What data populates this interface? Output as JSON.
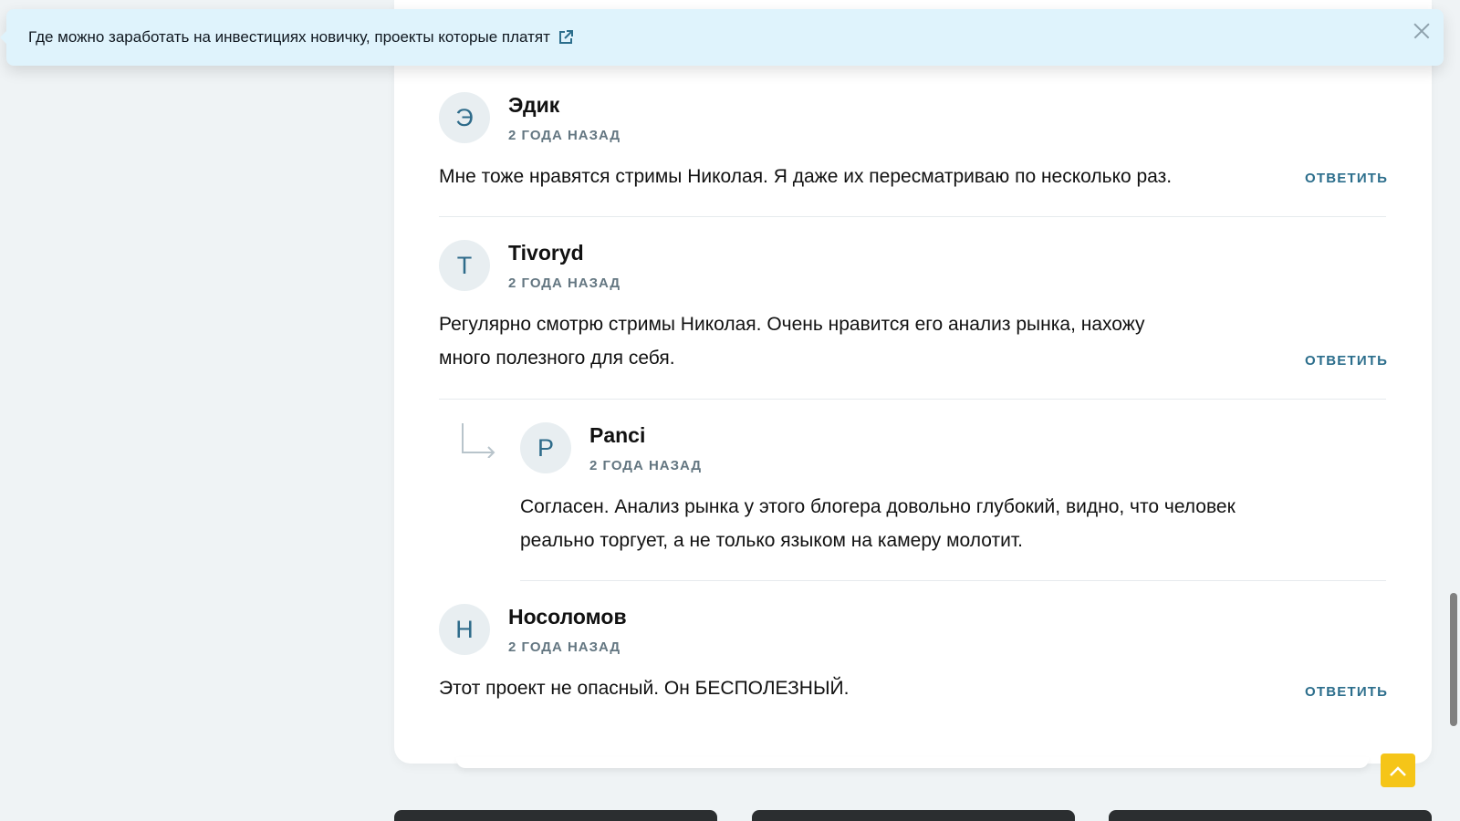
{
  "banner": {
    "link_text": "Где можно заработать на инвестициях новичку, проекты которые платят",
    "icons": {
      "external": "external-link-icon",
      "close": "close-icon"
    }
  },
  "comments": [
    {
      "avatar_letter": "Э",
      "author": "Эдик",
      "date": "2 ГОДА НАЗАД",
      "lines": [
        "Мне тоже нравятся стримы Николая. Я даже их пересматриваю по несколько раз."
      ],
      "reply_label": "ОТВЕТИТЬ"
    },
    {
      "avatar_letter": "T",
      "author": "Tivoryd",
      "date": "2 ГОДА НАЗАД",
      "lines": [
        "Регулярно смотрю стримы Николая. Очень нравится его анализ рынка, нахожу",
        "много полезного для себя."
      ],
      "reply_label": "ОТВЕТИТЬ"
    },
    {
      "avatar_letter": "P",
      "author": "Panci",
      "date": "2 ГОДА НАЗАД",
      "lines": [
        "Согласен. Анализ рынка у этого блогера довольно глубокий, видно, что человек",
        "реально торгует, а не только языком на камеру молотит."
      ]
    },
    {
      "avatar_letter": "Н",
      "author": "Носоломов",
      "date": "2 ГОДА НАЗАД",
      "lines": [
        "Этот проект не опасный. Он БЕСПОЛЕЗНЫЙ."
      ],
      "reply_label": "ОТВЕТИТЬ"
    }
  ],
  "colors": {
    "accent": "#2c6e8c",
    "banner_bg": "#dff3fc",
    "scroll_top_button": "#f5c518",
    "page_bg": "#eff3f5"
  },
  "icons": {
    "scroll_top": "chevron-up-icon",
    "nested_reply": "reply-arrow-icon"
  }
}
